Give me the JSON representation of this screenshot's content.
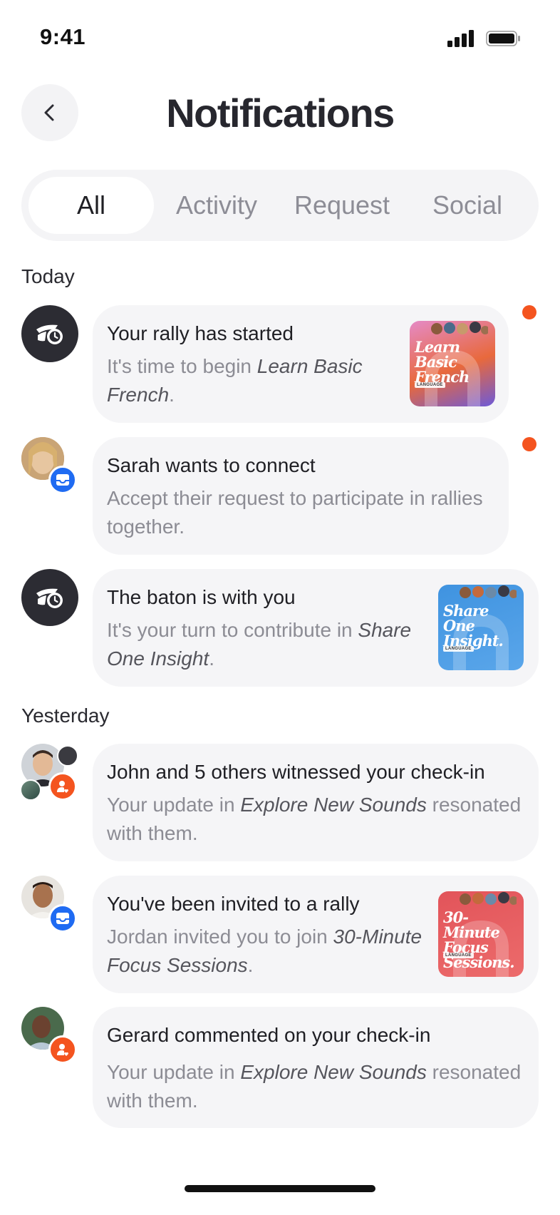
{
  "status_bar": {
    "time": "9:41"
  },
  "header": {
    "title": "Notifications"
  },
  "tabs": [
    {
      "label": "All",
      "active": true
    },
    {
      "label": "Activity",
      "active": false
    },
    {
      "label": "Request",
      "active": false
    },
    {
      "label": "Social",
      "active": false
    }
  ],
  "sections": {
    "today": "Today",
    "yesterday": "Yesterday"
  },
  "notifications": [
    {
      "title": "Your rally has started",
      "body_pre": "It's time to begin ",
      "body_em": "Learn Basic French",
      "body_post": ".",
      "thumb_title": "Learn Basic French",
      "thumb_tag": "LANGUAGE",
      "unread": true,
      "icon": "rally-app-icon"
    },
    {
      "title": "Sarah wants to connect",
      "body_pre": "Accept their request to participate in rallies together.",
      "body_em": "",
      "body_post": "",
      "unread": true,
      "badge": "inbox-icon"
    },
    {
      "title": "The baton is with you",
      "body_pre": "It's your turn to contribute in ",
      "body_em": "Share One Insight",
      "body_post": ".",
      "thumb_title": "Share One Insight.",
      "thumb_tag": "LANGUAGE",
      "unread": false,
      "icon": "rally-app-icon"
    },
    {
      "title": "John and 5 others witnessed your check-in",
      "body_pre": "Your update in ",
      "body_em": "Explore New Sounds",
      "body_post": " resonated with them.",
      "unread": false,
      "badge": "person-heart-icon"
    },
    {
      "title": "You've been invited to a rally",
      "body_pre": "Jordan invited you to join ",
      "body_em": "30-Minute Focus Sessions",
      "body_post": ".",
      "thumb_title": "30-Minute Focus Sessions.",
      "thumb_tag": "LANGUAGE",
      "unread": false,
      "badge": "inbox-icon"
    },
    {
      "title": "Gerard commented on your check-in",
      "body_pre": "Your update in ",
      "body_em": "Explore New Sounds",
      "body_post": " resonated with them.",
      "unread": false,
      "badge": "person-heart-icon"
    }
  ],
  "colors": {
    "accent_orange": "#f4541f",
    "badge_blue": "#1f6bf2",
    "card_bg": "#f5f5f7",
    "thumb_french": "#e9663a",
    "thumb_insight": "#3f93e0",
    "thumb_focus": "#e2545a"
  }
}
